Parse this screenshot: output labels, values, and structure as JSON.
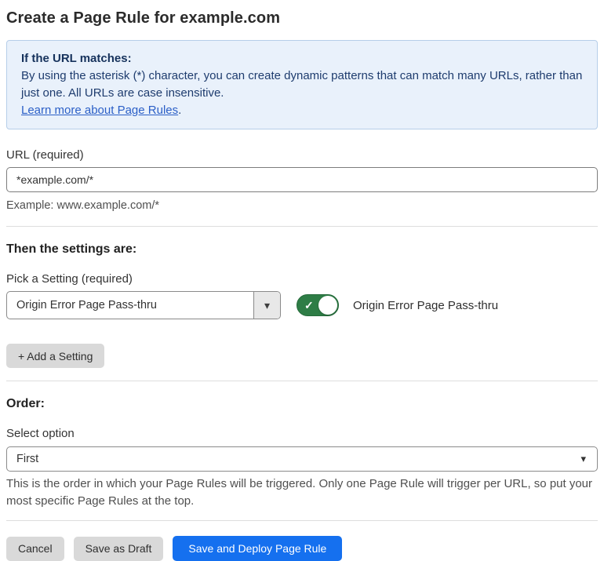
{
  "page": {
    "title": "Create a Page Rule for example.com"
  },
  "info_box": {
    "heading": "If the URL matches:",
    "body": "By using the asterisk (*) character, you can create dynamic patterns that can match many URLs, rather than just one. All URLs are case insensitive.",
    "link_text": "Learn more about Page Rules",
    "link_suffix": "."
  },
  "url_section": {
    "label": "URL (required)",
    "value": "*example.com/*",
    "helper": "Example: www.example.com/*"
  },
  "settings_section": {
    "heading": "Then the settings are:",
    "pick_label": "Pick a Setting (required)",
    "selected_setting": "Origin Error Page Pass-thru",
    "toggle_state": "on",
    "toggle_label": "Origin Error Page Pass-thru",
    "add_button_label": "+ Add a Setting"
  },
  "order_section": {
    "heading": "Order:",
    "label": "Select option",
    "selected_option": "First",
    "helper": "This is the order in which your Page Rules will be triggered. Only one Page Rule will trigger per URL, so put your most specific Page Rules at the top."
  },
  "footer": {
    "cancel_label": "Cancel",
    "save_draft_label": "Save as Draft",
    "save_deploy_label": "Save and Deploy Page Rule"
  },
  "icons": {
    "toggle_check": "✓",
    "dropdown_caret": "▾",
    "select_caret": "▾"
  },
  "colors": {
    "primary_blue": "#1570ef",
    "toggle_green": "#2e7d46",
    "info_background": "#e9f1fb",
    "info_border": "#b6cee9",
    "info_text": "#1e3c6e",
    "link_blue": "#2b5fc7"
  }
}
